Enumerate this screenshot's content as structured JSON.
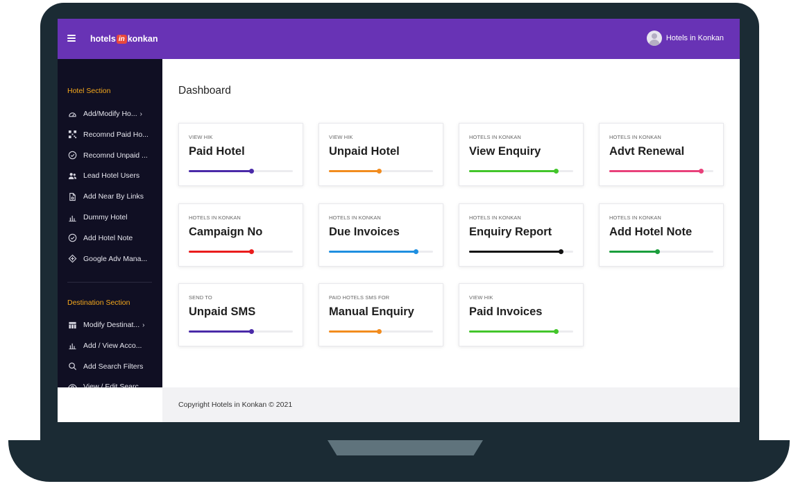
{
  "header": {
    "logo_left": "hotels",
    "logo_mark": "in",
    "logo_right": "konkan",
    "user_name": "Hotels in Konkan"
  },
  "sidebar": {
    "hotel_section_title": "Hotel Section",
    "hotel_items": [
      {
        "label": "Add/Modify Ho...",
        "icon": "dashboard-gauge-icon",
        "has_chevron": true
      },
      {
        "label": "Recomnd Paid Ho...",
        "icon": "qr-grid-icon",
        "has_chevron": false
      },
      {
        "label": "Recomnd Unpaid ...",
        "icon": "check-circle-icon",
        "has_chevron": false
      },
      {
        "label": "Lead Hotel Users",
        "icon": "users-icon",
        "has_chevron": false
      },
      {
        "label": "Add Near By Links",
        "icon": "document-link-icon",
        "has_chevron": false
      },
      {
        "label": "Dummy Hotel",
        "icon": "bar-chart-icon",
        "has_chevron": false
      },
      {
        "label": "Add Hotel Note",
        "icon": "check-circle-icon",
        "has_chevron": false
      },
      {
        "label": "Google Adv Mana...",
        "icon": "puzzle-icon",
        "has_chevron": false
      }
    ],
    "destination_section_title": "Destination Section",
    "destination_items": [
      {
        "label": "Modify Destinat...",
        "icon": "table-icon",
        "has_chevron": true
      },
      {
        "label": "Add / View Acco...",
        "icon": "bar-chart-icon",
        "has_chevron": false
      },
      {
        "label": "Add Search Filters",
        "icon": "search-icon",
        "has_chevron": false
      },
      {
        "label": "View / Edit Searc...",
        "icon": "eye-icon",
        "has_chevron": false
      }
    ],
    "chevron": "›"
  },
  "main": {
    "page_title": "Dashboard",
    "cards": [
      {
        "subtitle": "VIEW HIK",
        "title": "Paid Hotel",
        "color": "#4a2aa8",
        "progress": 0.6
      },
      {
        "subtitle": "VIEW HIK",
        "title": "Unpaid Hotel",
        "color": "#f28c1e",
        "progress": 0.48
      },
      {
        "subtitle": "HOTELS IN KONKAN",
        "title": "View Enquiry",
        "color": "#43c62b",
        "progress": 0.83
      },
      {
        "subtitle": "HOTELS IN KONKAN",
        "title": "Advt Renewal",
        "color": "#e8417a",
        "progress": 0.88
      },
      {
        "subtitle": "HOTELS IN KONKAN",
        "title": "Campaign No",
        "color": "#ea1c1c",
        "progress": 0.6
      },
      {
        "subtitle": "HOTELS IN KONKAN",
        "title": "Due Invoices",
        "color": "#1f8fe0",
        "progress": 0.83
      },
      {
        "subtitle": "HOTELS IN KONKAN",
        "title": "Enquiry Report",
        "color": "#111111",
        "progress": 0.88
      },
      {
        "subtitle": "HOTELS IN KONKAN",
        "title": "Add Hotel Note",
        "color": "#1a9e3c",
        "progress": 0.46
      },
      {
        "subtitle": "SEND TO",
        "title": "Unpaid SMS",
        "color": "#4a2aa8",
        "progress": 0.6
      },
      {
        "subtitle": "PAID HOTELS SMS FOR",
        "title": "Manual Enquiry",
        "color": "#f28c1e",
        "progress": 0.48
      },
      {
        "subtitle": "VIEW HIK",
        "title": "Paid Invoices",
        "color": "#43c62b",
        "progress": 0.83
      }
    ]
  },
  "footer": {
    "copyright": "Copyright Hotels in Konkan © 2021"
  }
}
